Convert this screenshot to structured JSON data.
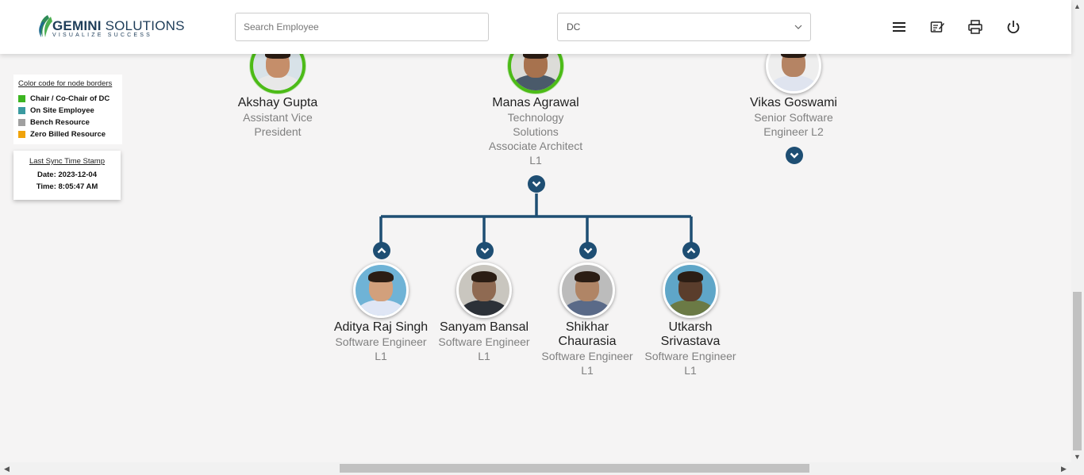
{
  "header": {
    "logo_brand": "GEMINI",
    "logo_suffix": "SOLUTIONS",
    "logo_tagline": "VISUALIZE SUCCESS",
    "search_placeholder": "Search Employee",
    "select_value": "DC",
    "icons": [
      "menu-icon",
      "edit-note-icon",
      "print-icon",
      "power-icon"
    ]
  },
  "legend": {
    "title": "Color code for node borders",
    "items": [
      {
        "label": "Chair / Co-Chair of DC",
        "color": "#3cb521"
      },
      {
        "label": "On Site Employee",
        "color": "#3a9aa0"
      },
      {
        "label": "Bench Resource",
        "color": "#a0a0a0"
      },
      {
        "label": "Zero Billed Resource",
        "color": "#f0a30a"
      }
    ]
  },
  "sync": {
    "title": "Last Sync Time Stamp",
    "date": "Date: 2023-12-04",
    "time": "Time: 8:05:47 AM"
  },
  "top_nodes": [
    {
      "name": "Akshay Gupta",
      "role_lines": [
        "Assistant Vice",
        "President"
      ],
      "border": "chair"
    },
    {
      "name": "Manas Agrawal",
      "role_lines": [
        "Technology",
        "Solutions",
        "Associate Architect",
        "L1"
      ],
      "border": "chair"
    },
    {
      "name": "Vikas Goswami",
      "role_lines": [
        "Senior Software",
        "Engineer L2"
      ],
      "border": "none"
    }
  ],
  "child_nodes": [
    {
      "name_lines": [
        "Aditya Raj Singh"
      ],
      "role_lines": [
        "Software Engineer",
        "L1"
      ]
    },
    {
      "name_lines": [
        "Sanyam Bansal"
      ],
      "role_lines": [
        "Software Engineer",
        "L1"
      ]
    },
    {
      "name_lines": [
        "Shikhar",
        "Chaurasia"
      ],
      "role_lines": [
        "Software Engineer",
        "L1"
      ]
    },
    {
      "name_lines": [
        "Utkarsh",
        "Srivastava"
      ],
      "role_lines": [
        "Software Engineer",
        "L1"
      ]
    }
  ],
  "colors": {
    "accent": "#1e4e73",
    "chair_border": "#4cbb17"
  }
}
